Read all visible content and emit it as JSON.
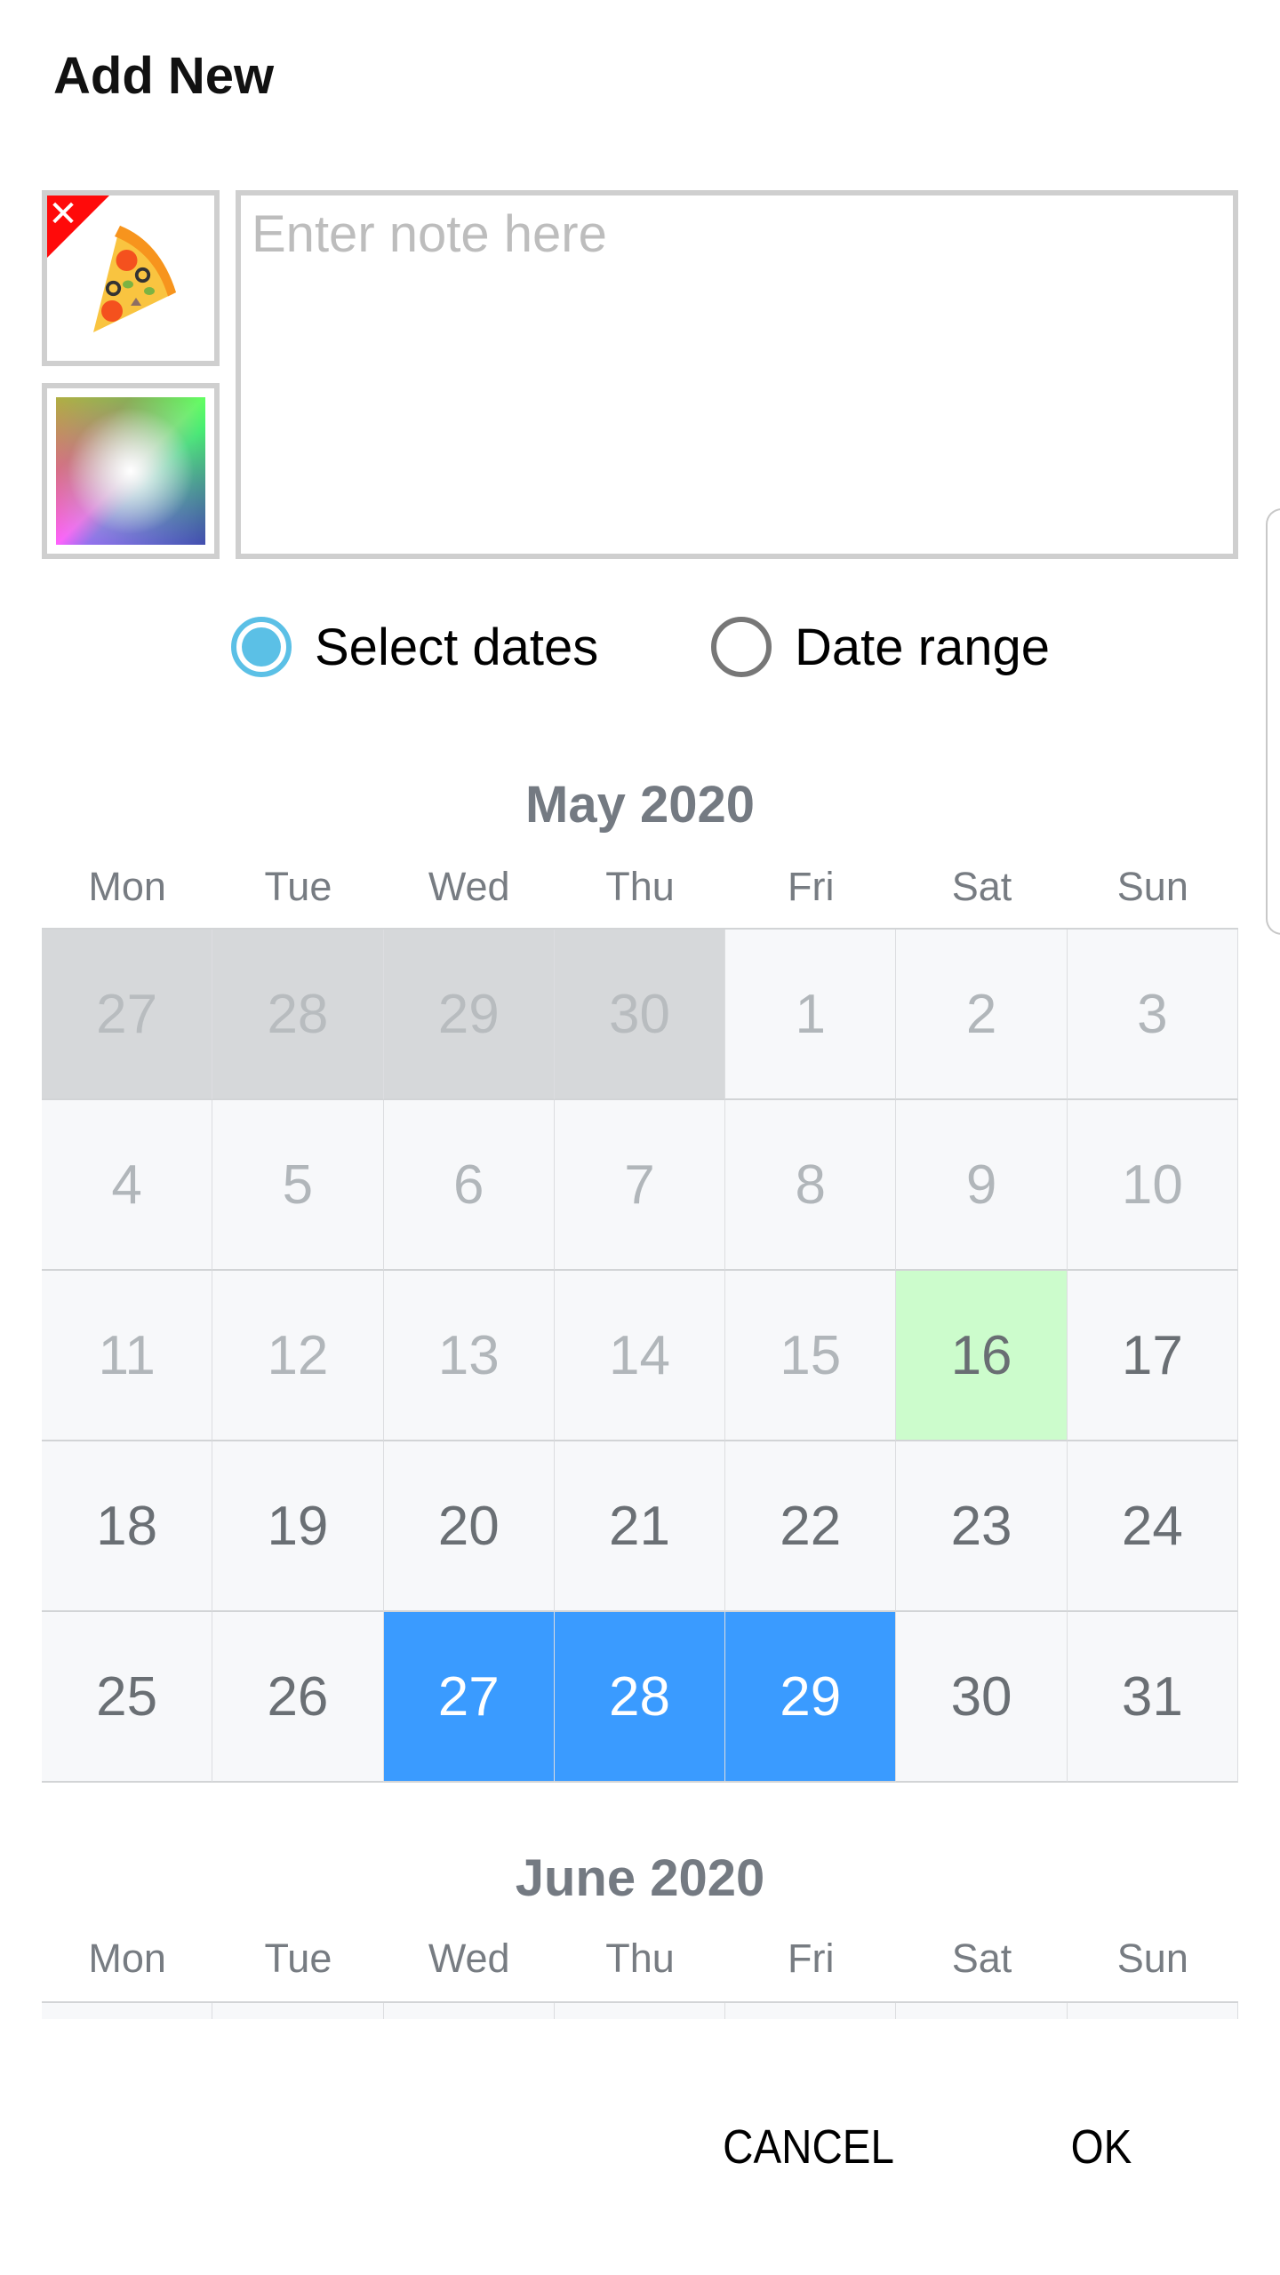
{
  "dialog": {
    "title": "Add New"
  },
  "note": {
    "placeholder": "Enter note here",
    "value": ""
  },
  "icon": {
    "name": "pizza-icon",
    "remove_icon": "close-icon",
    "remove_glyph": "✕"
  },
  "color_picker": {
    "name": "color-swatch"
  },
  "mode": {
    "options": [
      {
        "label": "Select dates",
        "selected": true
      },
      {
        "label": "Date range",
        "selected": false
      }
    ]
  },
  "colors": {
    "accent": "#5bc0e6",
    "selected_day": "#3a9bff",
    "today": "#ccfccc",
    "other_month": "#d6d8da"
  },
  "months": [
    {
      "title": "May 2020",
      "weekdays": [
        "Mon",
        "Tue",
        "Wed",
        "Thu",
        "Fri",
        "Sat",
        "Sun"
      ],
      "weeks": [
        [
          {
            "d": "27",
            "s": "other"
          },
          {
            "d": "28",
            "s": "other"
          },
          {
            "d": "29",
            "s": "other"
          },
          {
            "d": "30",
            "s": "other"
          },
          {
            "d": "1",
            "s": "past"
          },
          {
            "d": "2",
            "s": "past"
          },
          {
            "d": "3",
            "s": "past"
          }
        ],
        [
          {
            "d": "4",
            "s": "past"
          },
          {
            "d": "5",
            "s": "past"
          },
          {
            "d": "6",
            "s": "past"
          },
          {
            "d": "7",
            "s": "past"
          },
          {
            "d": "8",
            "s": "past"
          },
          {
            "d": "9",
            "s": "past"
          },
          {
            "d": "10",
            "s": "past"
          }
        ],
        [
          {
            "d": "11",
            "s": "past"
          },
          {
            "d": "12",
            "s": "past"
          },
          {
            "d": "13",
            "s": "past"
          },
          {
            "d": "14",
            "s": "past"
          },
          {
            "d": "15",
            "s": "past"
          },
          {
            "d": "16",
            "s": "today"
          },
          {
            "d": "17",
            "s": "future"
          }
        ],
        [
          {
            "d": "18",
            "s": "future"
          },
          {
            "d": "19",
            "s": "future"
          },
          {
            "d": "20",
            "s": "future"
          },
          {
            "d": "21",
            "s": "future"
          },
          {
            "d": "22",
            "s": "future"
          },
          {
            "d": "23",
            "s": "future"
          },
          {
            "d": "24",
            "s": "future"
          }
        ],
        [
          {
            "d": "25",
            "s": "future"
          },
          {
            "d": "26",
            "s": "future"
          },
          {
            "d": "27",
            "s": "selected"
          },
          {
            "d": "28",
            "s": "selected"
          },
          {
            "d": "29",
            "s": "selected"
          },
          {
            "d": "30",
            "s": "future"
          },
          {
            "d": "31",
            "s": "future"
          }
        ]
      ]
    },
    {
      "title": "June 2020",
      "weekdays": [
        "Mon",
        "Tue",
        "Wed",
        "Thu",
        "Fri",
        "Sat",
        "Sun"
      ],
      "weeks": [
        [
          {
            "d": "",
            "s": "future"
          },
          {
            "d": "",
            "s": "future"
          },
          {
            "d": "",
            "s": "future"
          },
          {
            "d": "",
            "s": "future"
          },
          {
            "d": "",
            "s": "future"
          },
          {
            "d": "",
            "s": "future"
          },
          {
            "d": "",
            "s": "future"
          }
        ]
      ]
    }
  ],
  "actions": {
    "cancel": "CANCEL",
    "ok": "OK"
  }
}
